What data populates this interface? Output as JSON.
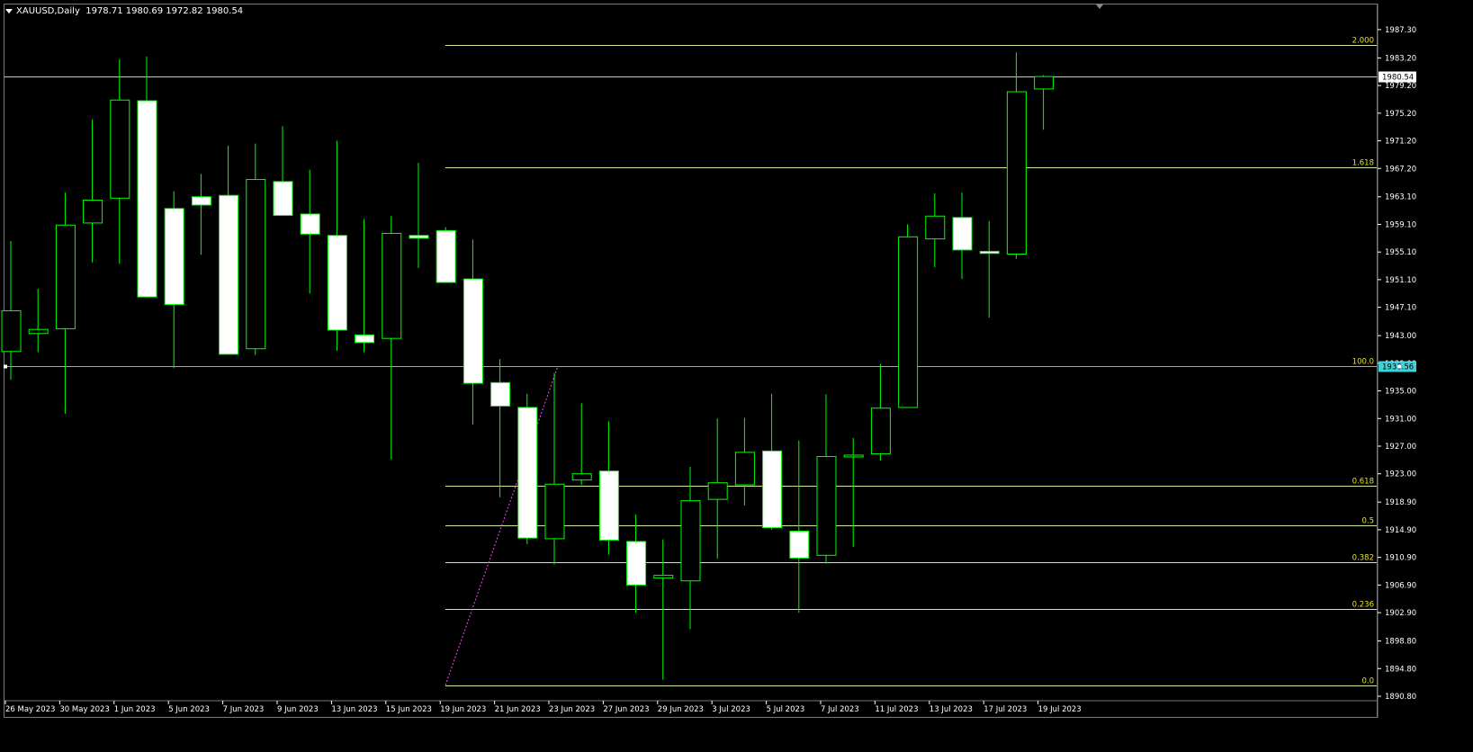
{
  "window": {
    "symbol": "XAUUSD,Daily",
    "ohlc": "1978.71 1980.69 1972.82 1980.54"
  },
  "colors": {
    "background": "#000000",
    "bull_body": "#000000",
    "bear_body": "#ffffff",
    "wick": "#00ff00",
    "fib": "#d0e89a",
    "fib_text": "#e8e020",
    "price_line": "#c8c8c8",
    "level_line": "#3fd0d8",
    "trend_line": "#ff40ff",
    "axis_text": "#ffffff"
  },
  "chart_data": {
    "type": "candlestick",
    "symbol": "XAUUSD",
    "timeframe": "Daily",
    "ylim": [
      1890.8,
      1989.5
    ],
    "y_ticks": [
      "1987.30",
      "1983.20",
      "1979.20",
      "1975.20",
      "1971.20",
      "1967.20",
      "1963.10",
      "1959.10",
      "1955.10",
      "1951.10",
      "1947.10",
      "1943.00",
      "1939.00",
      "1935.00",
      "1931.00",
      "1927.00",
      "1923.00",
      "1918.90",
      "1914.90",
      "1910.90",
      "1906.90",
      "1902.90",
      "1898.80",
      "1894.80",
      "1890.80"
    ],
    "x_tick_labels": [
      "26 May 2023",
      "30 May 2023",
      "1 Jun 2023",
      "5 Jun 2023",
      "7 Jun 2023",
      "9 Jun 2023",
      "13 Jun 2023",
      "15 Jun 2023",
      "19 Jun 2023",
      "21 Jun 2023",
      "23 Jun 2023",
      "27 Jun 2023",
      "29 Jun 2023",
      "3 Jul 2023",
      "5 Jul 2023",
      "7 Jul 2023",
      "11 Jul 2023",
      "13 Jul 2023",
      "17 Jul 2023",
      "19 Jul 2023"
    ],
    "candles": [
      {
        "o": 1940.7,
        "h": 1956.7,
        "l": 1936.6,
        "c": 1946.6
      },
      {
        "o": 1943.3,
        "h": 1949.8,
        "l": 1940.6,
        "c": 1943.9
      },
      {
        "o": 1944.0,
        "h": 1963.7,
        "l": 1931.7,
        "c": 1959.0
      },
      {
        "o": 1959.3,
        "h": 1974.3,
        "l": 1953.6,
        "c": 1962.6
      },
      {
        "o": 1962.9,
        "h": 1983.0,
        "l": 1953.4,
        "c": 1977.1
      },
      {
        "o": 1977.0,
        "h": 1983.4,
        "l": 1948.5,
        "c": 1948.6
      },
      {
        "o": 1961.4,
        "h": 1963.9,
        "l": 1938.3,
        "c": 1947.5
      },
      {
        "o": 1963.1,
        "h": 1966.4,
        "l": 1954.7,
        "c": 1961.9
      },
      {
        "o": 1963.3,
        "h": 1970.5,
        "l": 1940.9,
        "c": 1940.3
      },
      {
        "o": 1941.1,
        "h": 1970.8,
        "l": 1940.2,
        "c": 1965.6
      },
      {
        "o": 1965.3,
        "h": 1973.3,
        "l": 1961.1,
        "c": 1960.4
      },
      {
        "o": 1960.6,
        "h": 1967.0,
        "l": 1949.1,
        "c": 1957.7
      },
      {
        "o": 1957.5,
        "h": 1971.2,
        "l": 1940.8,
        "c": 1943.8
      },
      {
        "o": 1943.1,
        "h": 1959.9,
        "l": 1940.6,
        "c": 1942.0
      },
      {
        "o": 1942.6,
        "h": 1960.3,
        "l": 1925.1,
        "c": 1957.8
      },
      {
        "o": 1957.5,
        "h": 1968.0,
        "l": 1952.8,
        "c": 1957.1
      },
      {
        "o": 1958.2,
        "h": 1958.7,
        "l": 1955.3,
        "c": 1950.7
      },
      {
        "o": 1951.2,
        "h": 1956.9,
        "l": 1930.1,
        "c": 1936.1
      },
      {
        "o": 1936.2,
        "h": 1939.6,
        "l": 1919.6,
        "c": 1932.8
      },
      {
        "o": 1932.6,
        "h": 1934.6,
        "l": 1912.8,
        "c": 1913.7
      },
      {
        "o": 1913.6,
        "h": 1937.6,
        "l": 1909.9,
        "c": 1921.5
      },
      {
        "o": 1922.1,
        "h": 1933.2,
        "l": 1921.4,
        "c": 1923.0
      },
      {
        "o": 1923.4,
        "h": 1930.6,
        "l": 1911.3,
        "c": 1913.4
      },
      {
        "o": 1913.2,
        "h": 1917.1,
        "l": 1902.9,
        "c": 1906.9
      },
      {
        "o": 1907.9,
        "h": 1913.5,
        "l": 1893.2,
        "c": 1908.3
      },
      {
        "o": 1907.5,
        "h": 1924.0,
        "l": 1900.5,
        "c": 1919.1
      },
      {
        "o": 1919.3,
        "h": 1931.0,
        "l": 1910.7,
        "c": 1921.7
      },
      {
        "o": 1921.4,
        "h": 1931.1,
        "l": 1918.4,
        "c": 1926.1
      },
      {
        "o": 1926.3,
        "h": 1934.6,
        "l": 1914.9,
        "c": 1915.2
      },
      {
        "o": 1914.7,
        "h": 1927.8,
        "l": 1902.9,
        "c": 1910.8
      },
      {
        "o": 1911.2,
        "h": 1934.5,
        "l": 1910.0,
        "c": 1925.5
      },
      {
        "o": 1925.6,
        "h": 1928.2,
        "l": 1912.4,
        "c": 1925.7
      },
      {
        "o": 1925.9,
        "h": 1938.9,
        "l": 1924.9,
        "c": 1932.5
      },
      {
        "o": 1932.6,
        "h": 1959.1,
        "l": 1932.6,
        "c": 1957.3
      },
      {
        "o": 1957.0,
        "h": 1963.6,
        "l": 1952.9,
        "c": 1960.3
      },
      {
        "o": 1960.1,
        "h": 1963.7,
        "l": 1951.2,
        "c": 1955.4
      },
      {
        "o": 1955.2,
        "h": 1959.6,
        "l": 1945.6,
        "c": 1954.9
      },
      {
        "o": 1954.8,
        "h": 1984.0,
        "l": 1954.1,
        "c": 1978.3
      },
      {
        "o": 1978.7,
        "h": 1980.7,
        "l": 1972.8,
        "c": 1980.5
      }
    ],
    "fibonacci": {
      "levels": [
        {
          "label": "0.0",
          "price": 1892.4
        },
        {
          "label": "0.236",
          "price": 1903.4
        },
        {
          "label": "0.382",
          "price": 1910.2
        },
        {
          "label": "0.5",
          "price": 1915.6
        },
        {
          "label": "0.618",
          "price": 1921.3
        },
        {
          "label": "100.0",
          "price": 1938.56
        },
        {
          "label": "1.618",
          "price": 1967.3
        },
        {
          "label": "2.000",
          "price": 1985.1
        }
      ]
    },
    "current_price": "1980.54",
    "level_price": "1938.56"
  }
}
